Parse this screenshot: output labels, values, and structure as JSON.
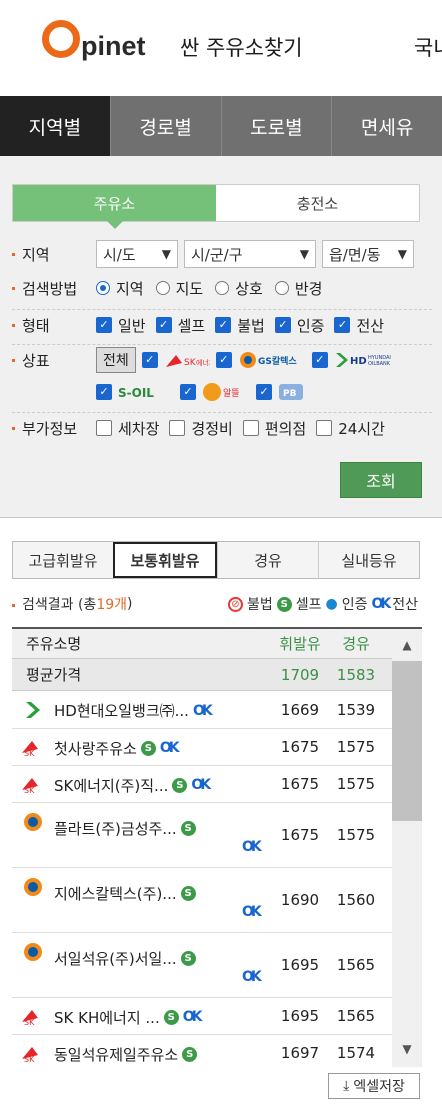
{
  "header": {
    "brand": "pinet",
    "title": "싼 주유소찾기",
    "title_right": "국내"
  },
  "tabs": [
    {
      "label": "지역별"
    },
    {
      "label": "경로별"
    },
    {
      "label": "도로별"
    },
    {
      "label": "면세유"
    }
  ],
  "filter": {
    "seg": [
      "주유소",
      "충전소"
    ],
    "region": {
      "label": "지역",
      "sido": "시/도",
      "sigungu": "시/군/구",
      "dong": "읍/면/동"
    },
    "method": {
      "label": "검색방법",
      "options": [
        "지역",
        "지도",
        "상호",
        "반경"
      ]
    },
    "type": {
      "label": "형태",
      "options": [
        "일반",
        "셀프",
        "불법",
        "인증",
        "전산"
      ]
    },
    "brand": {
      "label": "상표",
      "all": "전체",
      "brands": [
        "SK에너지",
        "GS칼텍스",
        "HD현대오일뱅크",
        "S-OIL",
        "알뜰",
        "PB"
      ]
    },
    "extra": {
      "label": "부가정보",
      "options": [
        "세차장",
        "경정비",
        "편의점",
        "24시간"
      ]
    },
    "search": "조회"
  },
  "fuel_tabs": [
    "고급휘발유",
    "보통휘발유",
    "경유",
    "실내등유"
  ],
  "result": {
    "label": "검색결과 (총 ",
    "count": "19개",
    "close": ")",
    "legend": [
      "불법",
      "셀프",
      "인증",
      "전산"
    ]
  },
  "table": {
    "header": {
      "name": "주유소명",
      "gas": "휘발유",
      "diesel": "경유"
    },
    "avg": {
      "name": "평균가격",
      "gas": "1709",
      "diesel": "1583"
    },
    "rows": [
      {
        "name": "HD현대오일뱅크㈜...",
        "gas": "1669",
        "diesel": "1539",
        "brand": "hd"
      },
      {
        "name": "첫사랑주유소",
        "gas": "1675",
        "diesel": "1575",
        "brand": "sk"
      },
      {
        "name": "SK에너지(주)직...",
        "gas": "1675",
        "diesel": "1575",
        "brand": "sk"
      },
      {
        "name": "플라트(주)금성주...",
        "gas": "1675",
        "diesel": "1575",
        "brand": "gs"
      },
      {
        "name": "지에스칼텍스(주)...",
        "gas": "1690",
        "diesel": "1560",
        "brand": "gs"
      },
      {
        "name": "서일석유(주)서일...",
        "gas": "1695",
        "diesel": "1565",
        "brand": "gs"
      },
      {
        "name": "SK KH에너지 ...",
        "gas": "1695",
        "diesel": "1565",
        "brand": "sk"
      },
      {
        "name": "동일석유제일주유소",
        "gas": "1697",
        "diesel": "1574",
        "brand": "sk"
      }
    ]
  },
  "excel": "엑셀저장",
  "colors": {
    "accent": "#ec6a17",
    "green": "#75c17a",
    "blue": "#1a66d0"
  }
}
